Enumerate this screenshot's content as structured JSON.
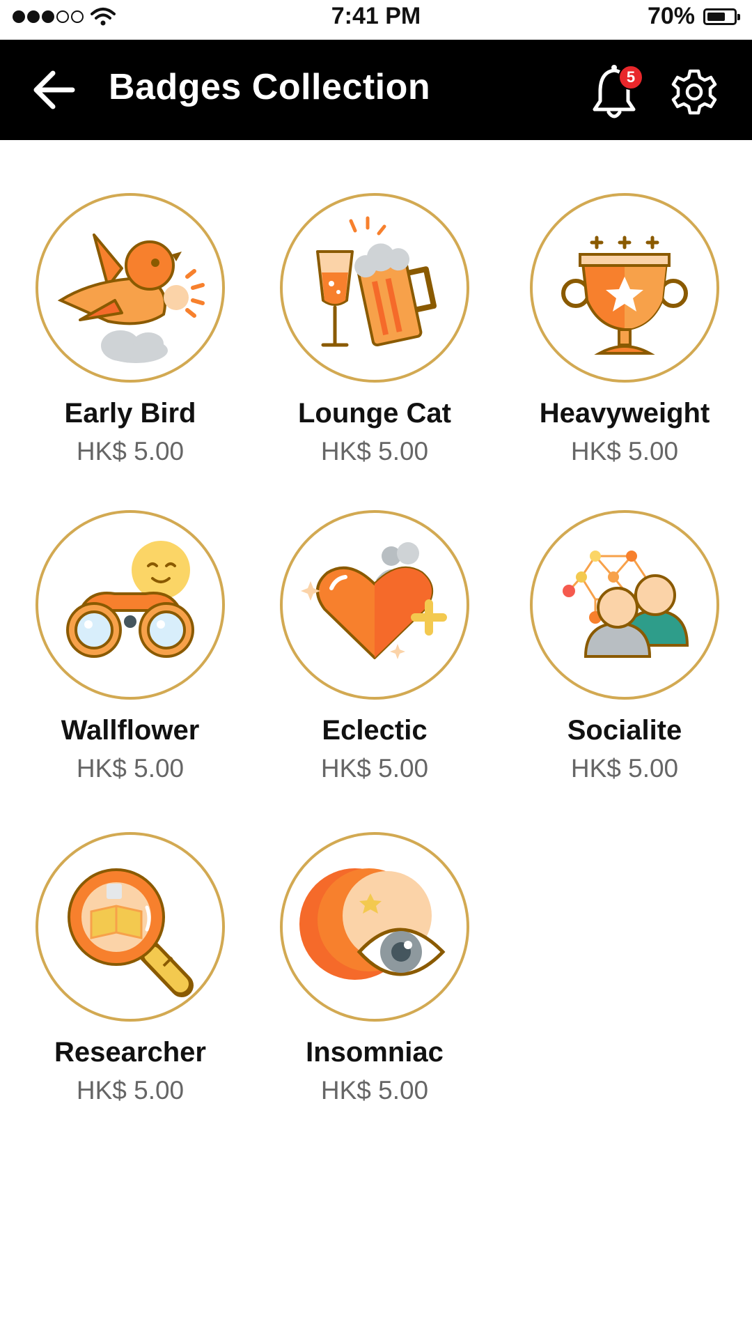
{
  "status_bar": {
    "time": "7:41 PM",
    "battery_percent": "70%",
    "battery_level": 0.7,
    "signal_bars": 3,
    "signal_total": 5
  },
  "header": {
    "title": "Badges Collection",
    "notification_count": "5",
    "icons": [
      "back-arrow-icon",
      "bell-icon",
      "gear-icon"
    ]
  },
  "badges": [
    {
      "name": "Early Bird",
      "price": "HK$ 5.00",
      "icon": "bird-icon"
    },
    {
      "name": "Lounge Cat",
      "price": "HK$ 5.00",
      "icon": "drinks-icon"
    },
    {
      "name": "Heavyweight",
      "price": "HK$ 5.00",
      "icon": "trophy-icon"
    },
    {
      "name": "Wallflower",
      "price": "HK$ 5.00",
      "icon": "binoculars-icon"
    },
    {
      "name": "Eclectic",
      "price": "HK$ 5.00",
      "icon": "heart-icon"
    },
    {
      "name": "Socialite",
      "price": "HK$ 5.00",
      "icon": "network-people-icon"
    },
    {
      "name": "Researcher",
      "price": "HK$ 5.00",
      "icon": "magnifier-icon"
    },
    {
      "name": "Insomniac",
      "price": "HK$ 5.00",
      "icon": "moon-eye-icon"
    }
  ],
  "colors": {
    "header_bg": "#000000",
    "badge_border": "#d2a952",
    "accent_orange": "#f7802d",
    "notification_red": "#e8272b",
    "price_text": "#666666"
  }
}
